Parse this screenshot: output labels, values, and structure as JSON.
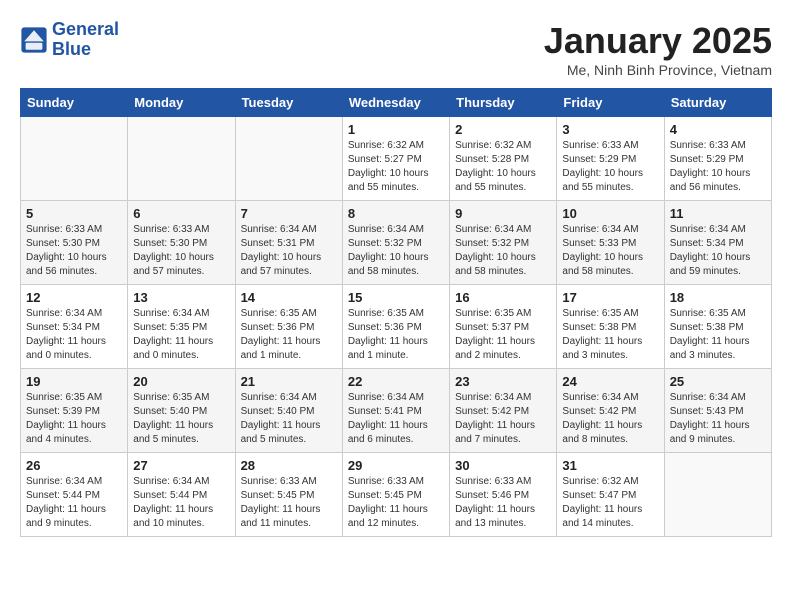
{
  "logo": {
    "line1": "General",
    "line2": "Blue"
  },
  "title": "January 2025",
  "subtitle": "Me, Ninh Binh Province, Vietnam",
  "days_of_week": [
    "Sunday",
    "Monday",
    "Tuesday",
    "Wednesday",
    "Thursday",
    "Friday",
    "Saturday"
  ],
  "weeks": [
    [
      {
        "day": "",
        "info": ""
      },
      {
        "day": "",
        "info": ""
      },
      {
        "day": "",
        "info": ""
      },
      {
        "day": "1",
        "info": "Sunrise: 6:32 AM\nSunset: 5:27 PM\nDaylight: 10 hours\nand 55 minutes."
      },
      {
        "day": "2",
        "info": "Sunrise: 6:32 AM\nSunset: 5:28 PM\nDaylight: 10 hours\nand 55 minutes."
      },
      {
        "day": "3",
        "info": "Sunrise: 6:33 AM\nSunset: 5:29 PM\nDaylight: 10 hours\nand 55 minutes."
      },
      {
        "day": "4",
        "info": "Sunrise: 6:33 AM\nSunset: 5:29 PM\nDaylight: 10 hours\nand 56 minutes."
      }
    ],
    [
      {
        "day": "5",
        "info": "Sunrise: 6:33 AM\nSunset: 5:30 PM\nDaylight: 10 hours\nand 56 minutes."
      },
      {
        "day": "6",
        "info": "Sunrise: 6:33 AM\nSunset: 5:30 PM\nDaylight: 10 hours\nand 57 minutes."
      },
      {
        "day": "7",
        "info": "Sunrise: 6:34 AM\nSunset: 5:31 PM\nDaylight: 10 hours\nand 57 minutes."
      },
      {
        "day": "8",
        "info": "Sunrise: 6:34 AM\nSunset: 5:32 PM\nDaylight: 10 hours\nand 58 minutes."
      },
      {
        "day": "9",
        "info": "Sunrise: 6:34 AM\nSunset: 5:32 PM\nDaylight: 10 hours\nand 58 minutes."
      },
      {
        "day": "10",
        "info": "Sunrise: 6:34 AM\nSunset: 5:33 PM\nDaylight: 10 hours\nand 58 minutes."
      },
      {
        "day": "11",
        "info": "Sunrise: 6:34 AM\nSunset: 5:34 PM\nDaylight: 10 hours\nand 59 minutes."
      }
    ],
    [
      {
        "day": "12",
        "info": "Sunrise: 6:34 AM\nSunset: 5:34 PM\nDaylight: 11 hours\nand 0 minutes."
      },
      {
        "day": "13",
        "info": "Sunrise: 6:34 AM\nSunset: 5:35 PM\nDaylight: 11 hours\nand 0 minutes."
      },
      {
        "day": "14",
        "info": "Sunrise: 6:35 AM\nSunset: 5:36 PM\nDaylight: 11 hours\nand 1 minute."
      },
      {
        "day": "15",
        "info": "Sunrise: 6:35 AM\nSunset: 5:36 PM\nDaylight: 11 hours\nand 1 minute."
      },
      {
        "day": "16",
        "info": "Sunrise: 6:35 AM\nSunset: 5:37 PM\nDaylight: 11 hours\nand 2 minutes."
      },
      {
        "day": "17",
        "info": "Sunrise: 6:35 AM\nSunset: 5:38 PM\nDaylight: 11 hours\nand 3 minutes."
      },
      {
        "day": "18",
        "info": "Sunrise: 6:35 AM\nSunset: 5:38 PM\nDaylight: 11 hours\nand 3 minutes."
      }
    ],
    [
      {
        "day": "19",
        "info": "Sunrise: 6:35 AM\nSunset: 5:39 PM\nDaylight: 11 hours\nand 4 minutes."
      },
      {
        "day": "20",
        "info": "Sunrise: 6:35 AM\nSunset: 5:40 PM\nDaylight: 11 hours\nand 5 minutes."
      },
      {
        "day": "21",
        "info": "Sunrise: 6:34 AM\nSunset: 5:40 PM\nDaylight: 11 hours\nand 5 minutes."
      },
      {
        "day": "22",
        "info": "Sunrise: 6:34 AM\nSunset: 5:41 PM\nDaylight: 11 hours\nand 6 minutes."
      },
      {
        "day": "23",
        "info": "Sunrise: 6:34 AM\nSunset: 5:42 PM\nDaylight: 11 hours\nand 7 minutes."
      },
      {
        "day": "24",
        "info": "Sunrise: 6:34 AM\nSunset: 5:42 PM\nDaylight: 11 hours\nand 8 minutes."
      },
      {
        "day": "25",
        "info": "Sunrise: 6:34 AM\nSunset: 5:43 PM\nDaylight: 11 hours\nand 9 minutes."
      }
    ],
    [
      {
        "day": "26",
        "info": "Sunrise: 6:34 AM\nSunset: 5:44 PM\nDaylight: 11 hours\nand 9 minutes."
      },
      {
        "day": "27",
        "info": "Sunrise: 6:34 AM\nSunset: 5:44 PM\nDaylight: 11 hours\nand 10 minutes."
      },
      {
        "day": "28",
        "info": "Sunrise: 6:33 AM\nSunset: 5:45 PM\nDaylight: 11 hours\nand 11 minutes."
      },
      {
        "day": "29",
        "info": "Sunrise: 6:33 AM\nSunset: 5:45 PM\nDaylight: 11 hours\nand 12 minutes."
      },
      {
        "day": "30",
        "info": "Sunrise: 6:33 AM\nSunset: 5:46 PM\nDaylight: 11 hours\nand 13 minutes."
      },
      {
        "day": "31",
        "info": "Sunrise: 6:32 AM\nSunset: 5:47 PM\nDaylight: 11 hours\nand 14 minutes."
      },
      {
        "day": "",
        "info": ""
      }
    ]
  ]
}
